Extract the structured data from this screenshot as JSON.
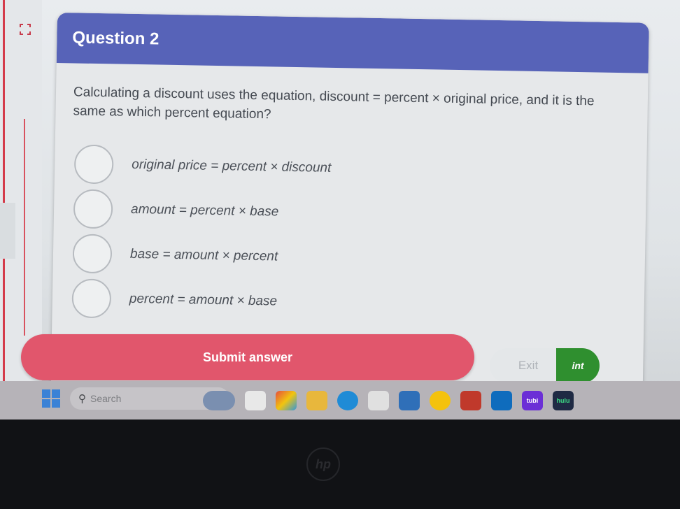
{
  "question": {
    "title": "Question 2",
    "text": "Calculating a discount uses the equation, discount = percent × original price, and it is the same as which percent equation?",
    "options": [
      "original price  = percent × discount",
      "amount = percent × base",
      "base = amount × percent",
      "percent = amount × base"
    ]
  },
  "actions": {
    "submit_label": "Submit answer",
    "exit_label": "Exit",
    "hint_label": "int"
  },
  "taskbar": {
    "search_placeholder": "Search",
    "icons": [
      "widgets-icon",
      "file-explorer-icon",
      "photos-icon",
      "folder-icon",
      "edge-icon",
      "store-icon",
      "weather-icon",
      "chrome-icon",
      "mcafee-icon",
      "outlook-icon",
      "tubi-icon",
      "hulu-icon"
    ],
    "tubi_label": "tubi",
    "hulu_label": "hulu"
  },
  "colors": {
    "header": "#5763b8",
    "submit": "#e1566c",
    "hint": "#2f8f2f"
  }
}
